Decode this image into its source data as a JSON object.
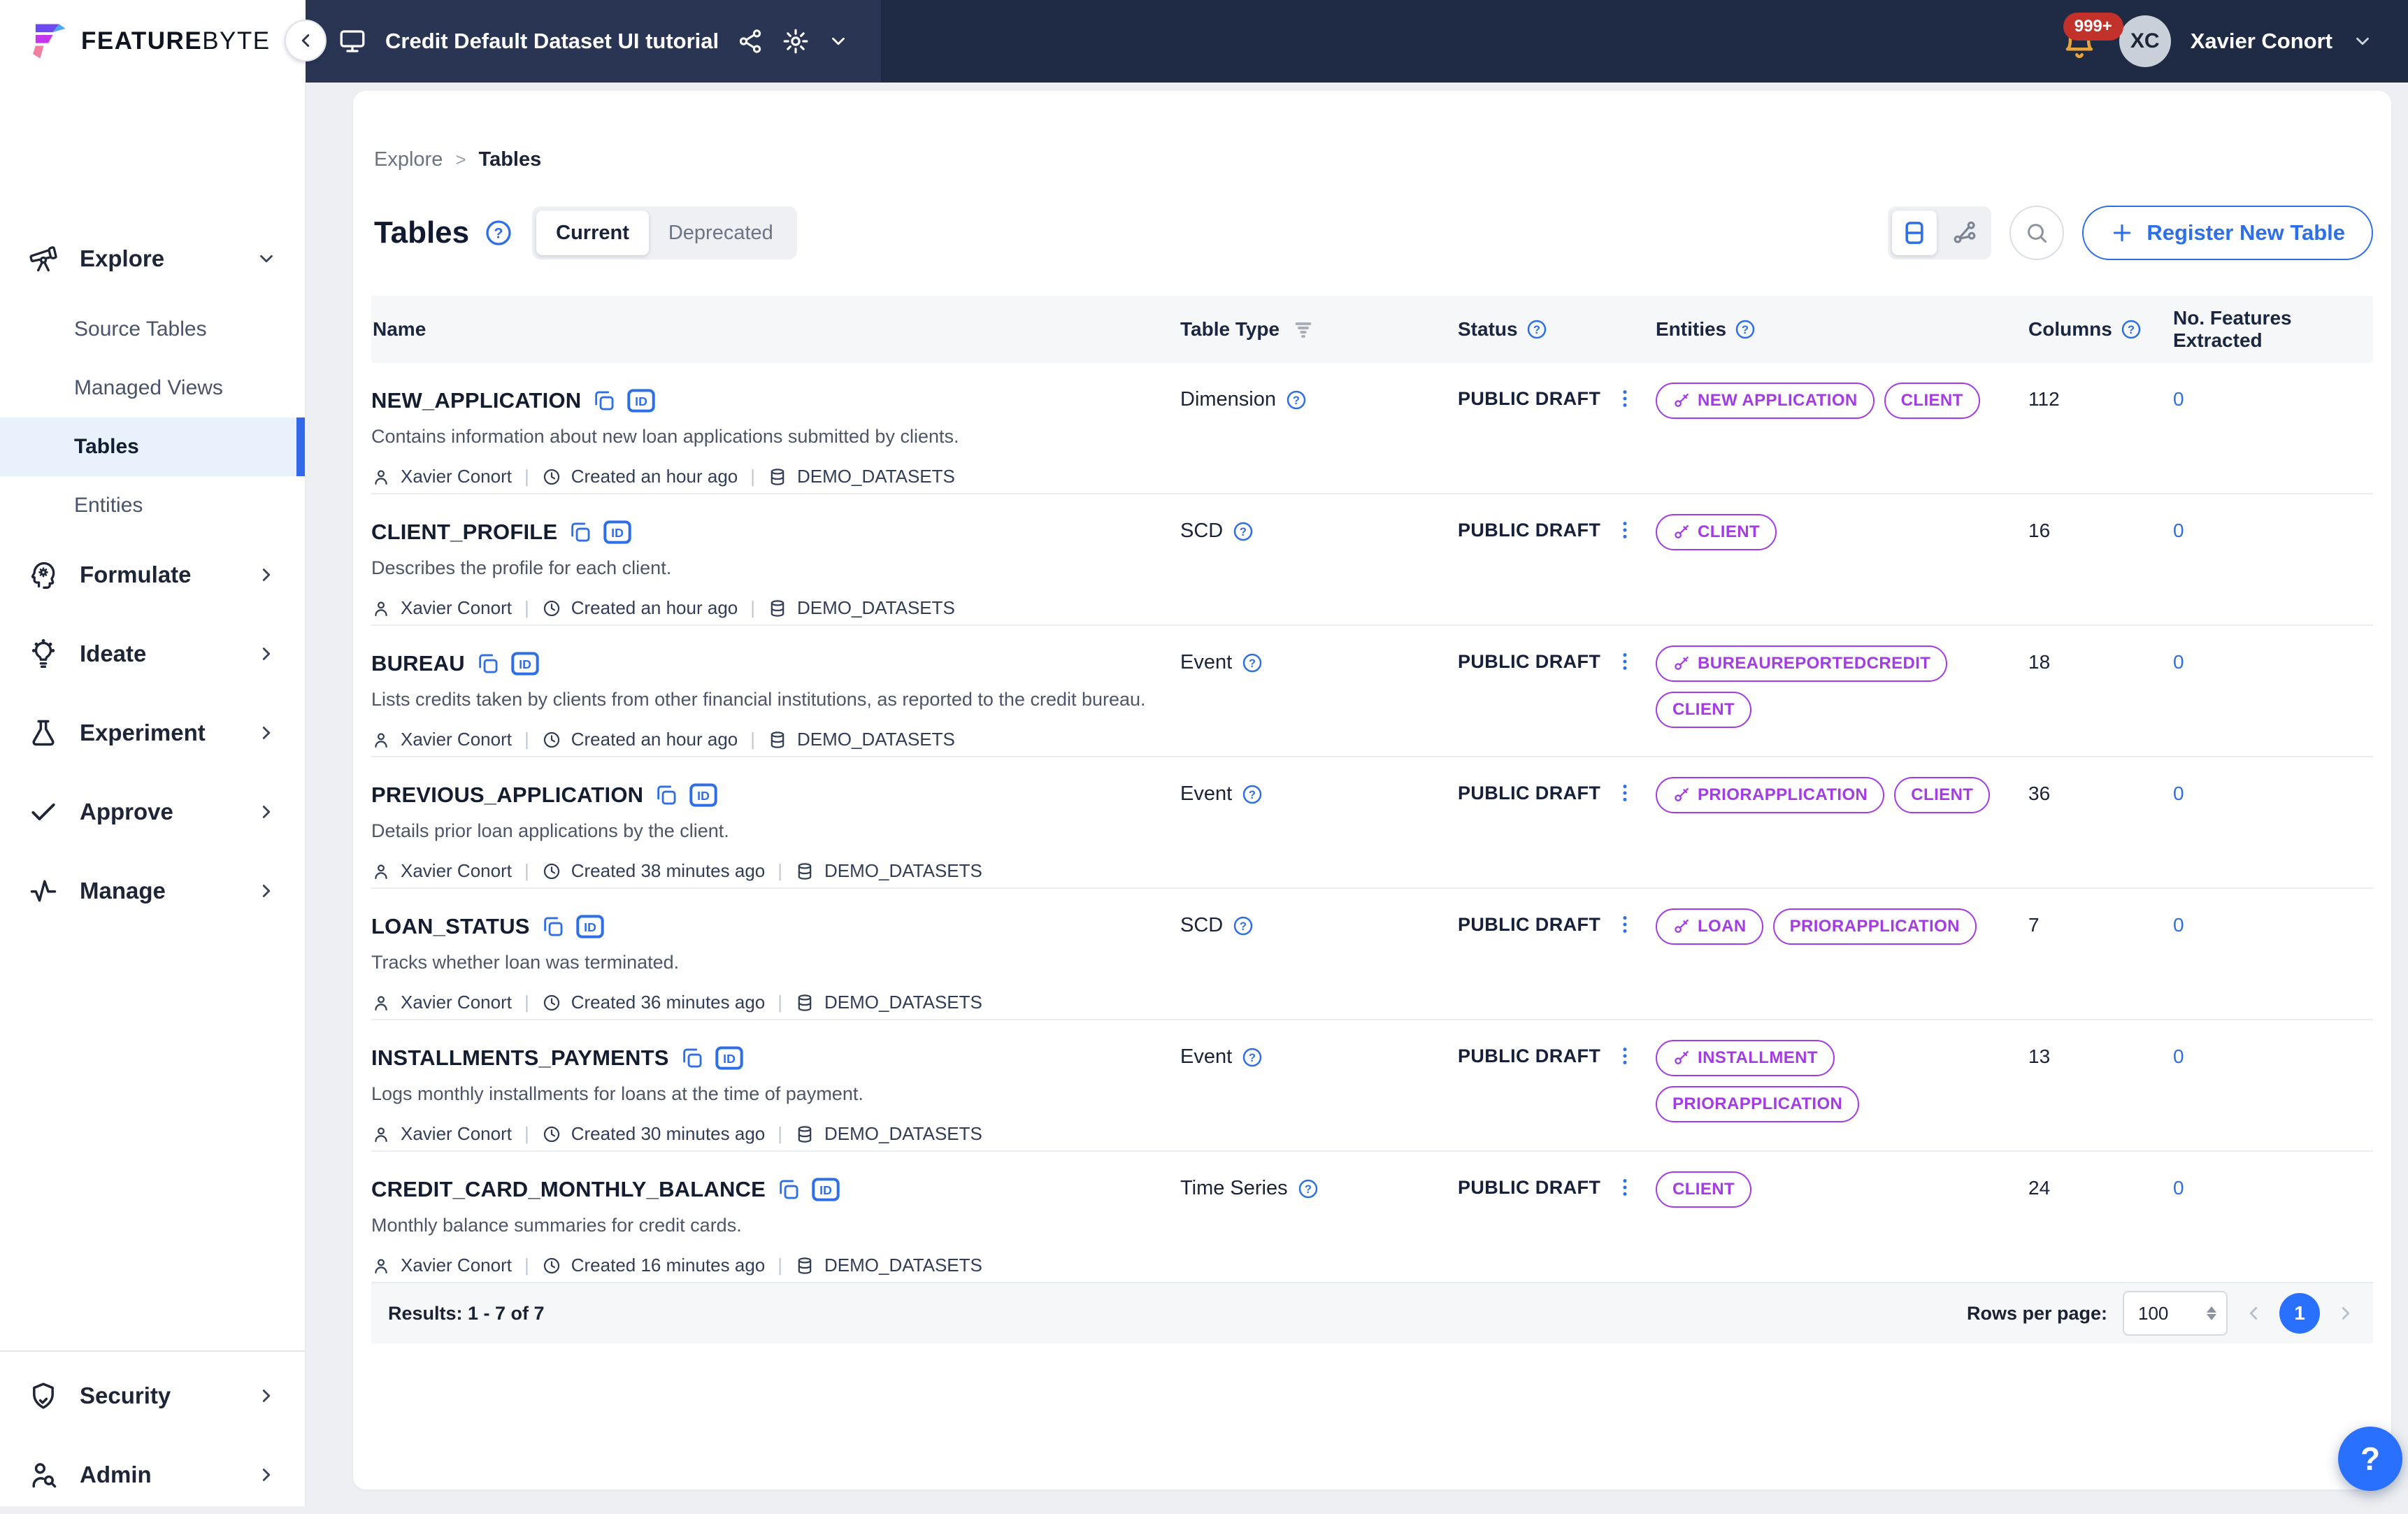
{
  "topbar": {
    "brand_feature": "FEATURE",
    "brand_byte": "BYTE",
    "project_title": "Credit Default Dataset UI tutorial",
    "notifications_badge": "999+",
    "user_initials": "XC",
    "user_name": "Xavier Conort"
  },
  "sidebar": {
    "explore": {
      "label": "Explore",
      "items": [
        {
          "label": "Source Tables"
        },
        {
          "label": "Managed Views"
        },
        {
          "label": "Tables"
        },
        {
          "label": "Entities"
        }
      ]
    },
    "sections": [
      {
        "label": "Formulate"
      },
      {
        "label": "Ideate"
      },
      {
        "label": "Experiment"
      },
      {
        "label": "Approve"
      },
      {
        "label": "Manage"
      }
    ],
    "bottom": [
      {
        "label": "Security"
      },
      {
        "label": "Admin"
      }
    ]
  },
  "breadcrumb": {
    "parent": "Explore",
    "current": "Tables"
  },
  "page": {
    "title": "Tables",
    "tab_current": "Current",
    "tab_deprecated": "Deprecated",
    "register_button": "Register New Table"
  },
  "table": {
    "headers": {
      "name": "Name",
      "type": "Table Type",
      "status": "Status",
      "entities": "Entities",
      "columns": "Columns",
      "features": "No. Features Extracted"
    },
    "rows": [
      {
        "name": "NEW_APPLICATION",
        "description": "Contains information about new loan applications submitted by clients.",
        "owner": "Xavier Conort",
        "created": "Created an hour ago",
        "source": "DEMO_DATASETS",
        "type": "Dimension",
        "status": "PUBLIC DRAFT",
        "columns": "112",
        "features": "0",
        "entities": [
          {
            "label": "NEW APPLICATION",
            "key": true
          },
          {
            "label": "CLIENT",
            "key": false
          }
        ]
      },
      {
        "name": "CLIENT_PROFILE",
        "description": "Describes the profile for each client.",
        "owner": "Xavier Conort",
        "created": "Created an hour ago",
        "source": "DEMO_DATASETS",
        "type": "SCD",
        "status": "PUBLIC DRAFT",
        "columns": "16",
        "features": "0",
        "entities": [
          {
            "label": "CLIENT",
            "key": true
          }
        ]
      },
      {
        "name": "BUREAU",
        "description": "Lists credits taken by clients from other financial institutions, as reported to the credit bureau.",
        "owner": "Xavier Conort",
        "created": "Created an hour ago",
        "source": "DEMO_DATASETS",
        "type": "Event",
        "status": "PUBLIC DRAFT",
        "columns": "18",
        "features": "0",
        "entities": [
          {
            "label": "BUREAUREPORTEDCREDIT",
            "key": true
          },
          {
            "label": "CLIENT",
            "key": false
          }
        ]
      },
      {
        "name": "PREVIOUS_APPLICATION",
        "description": "Details prior loan applications by the client.",
        "owner": "Xavier Conort",
        "created": "Created 38 minutes ago",
        "source": "DEMO_DATASETS",
        "type": "Event",
        "status": "PUBLIC DRAFT",
        "columns": "36",
        "features": "0",
        "entities": [
          {
            "label": "PRIORAPPLICATION",
            "key": true
          },
          {
            "label": "CLIENT",
            "key": false
          }
        ]
      },
      {
        "name": "LOAN_STATUS",
        "description": "Tracks whether loan was terminated.",
        "owner": "Xavier Conort",
        "created": "Created 36 minutes ago",
        "source": "DEMO_DATASETS",
        "type": "SCD",
        "status": "PUBLIC DRAFT",
        "columns": "7",
        "features": "0",
        "entities": [
          {
            "label": "LOAN",
            "key": true
          },
          {
            "label": "PRIORAPPLICATION",
            "key": false
          }
        ]
      },
      {
        "name": "INSTALLMENTS_PAYMENTS",
        "description": "Logs monthly installments for loans at the time of payment.",
        "owner": "Xavier Conort",
        "created": "Created 30 minutes ago",
        "source": "DEMO_DATASETS",
        "type": "Event",
        "status": "PUBLIC DRAFT",
        "columns": "13",
        "features": "0",
        "entities": [
          {
            "label": "INSTALLMENT",
            "key": true
          },
          {
            "label": "PRIORAPPLICATION",
            "key": false
          }
        ]
      },
      {
        "name": "CREDIT_CARD_MONTHLY_BALANCE",
        "description": "Monthly balance summaries for credit cards.",
        "owner": "Xavier Conort",
        "created": "Created 16 minutes ago",
        "source": "DEMO_DATASETS",
        "type": "Time Series",
        "status": "PUBLIC DRAFT",
        "columns": "24",
        "features": "0",
        "entities": [
          {
            "label": "CLIENT",
            "key": false
          }
        ]
      }
    ]
  },
  "footer": {
    "results": "Results: 1 - 7 of 7",
    "rows_per_page_label": "Rows per page:",
    "rows_per_page_value": "100",
    "page": "1"
  },
  "colors": {
    "accent_blue": "#2e6fe8",
    "chip_purple": "#a43be4",
    "topbar_navy": "#1f2a45",
    "badge_red": "#c2322a"
  },
  "icons": [
    "telescope-icon",
    "brain-gear-icon",
    "lightbulb-icon",
    "flask-icon",
    "check-icon",
    "activity-icon",
    "shield-check-icon",
    "user-search-icon",
    "monitor-icon",
    "share-icon",
    "gear-icon",
    "bell-icon",
    "copy-icon",
    "id-badge-icon",
    "person-icon",
    "clock-icon",
    "database-icon",
    "filter-funnel-icon",
    "question-circle-icon",
    "kebab-menu-icon",
    "table-view-icon",
    "graph-view-icon",
    "search-icon",
    "plus-icon",
    "key-icon",
    "chevron-icons",
    "help-icon"
  ]
}
